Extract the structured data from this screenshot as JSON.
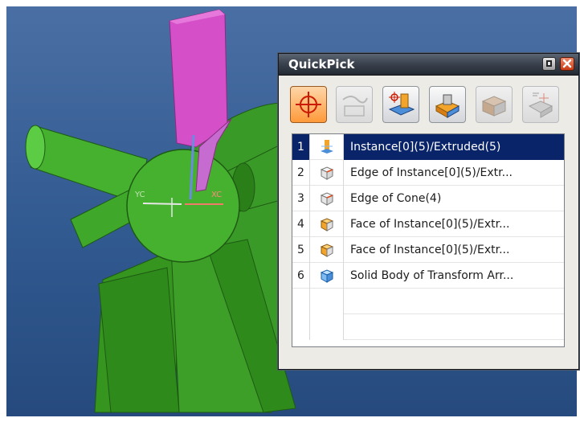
{
  "window": {
    "title": "QuickPick"
  },
  "filters": [
    {
      "name": "all-objects",
      "icon": "crosshair-icon",
      "state": "active"
    },
    {
      "name": "curves",
      "icon": "curve-icon",
      "state": "disabled"
    },
    {
      "name": "features",
      "icon": "feature-icon",
      "state": "normal"
    },
    {
      "name": "bodies",
      "icon": "body-icon",
      "state": "normal"
    },
    {
      "name": "components",
      "icon": "component-icon",
      "state": "disabled"
    },
    {
      "name": "other",
      "icon": "other-icon",
      "state": "disabled"
    }
  ],
  "items": [
    {
      "index": "1",
      "label": "Instance[0](5)/Extruded(5)",
      "icon": "extrude-feature-icon",
      "selected": true
    },
    {
      "index": "2",
      "label": "Edge of Instance[0](5)/Extr...",
      "icon": "edge-cube-icon",
      "selected": false
    },
    {
      "index": "3",
      "label": "Edge of Cone(4)",
      "icon": "edge-cube-icon",
      "selected": false
    },
    {
      "index": "4",
      "label": "Face of Instance[0](5)/Extr...",
      "icon": "face-cube-icon",
      "selected": false
    },
    {
      "index": "5",
      "label": "Face of Instance[0](5)/Extr...",
      "icon": "face-cube-icon",
      "selected": false
    },
    {
      "index": "6",
      "label": "Solid Body of Transform Arr...",
      "icon": "solid-body-icon",
      "selected": false
    }
  ],
  "scene": {
    "axis_labels": {
      "yc": "YC",
      "xc": "XC"
    },
    "colors": {
      "background": "#3a64a0",
      "part": "#3fa82a",
      "tool": "#d44fc8",
      "selection": "#0a246a",
      "active_filter": "#ff9a3b"
    }
  }
}
